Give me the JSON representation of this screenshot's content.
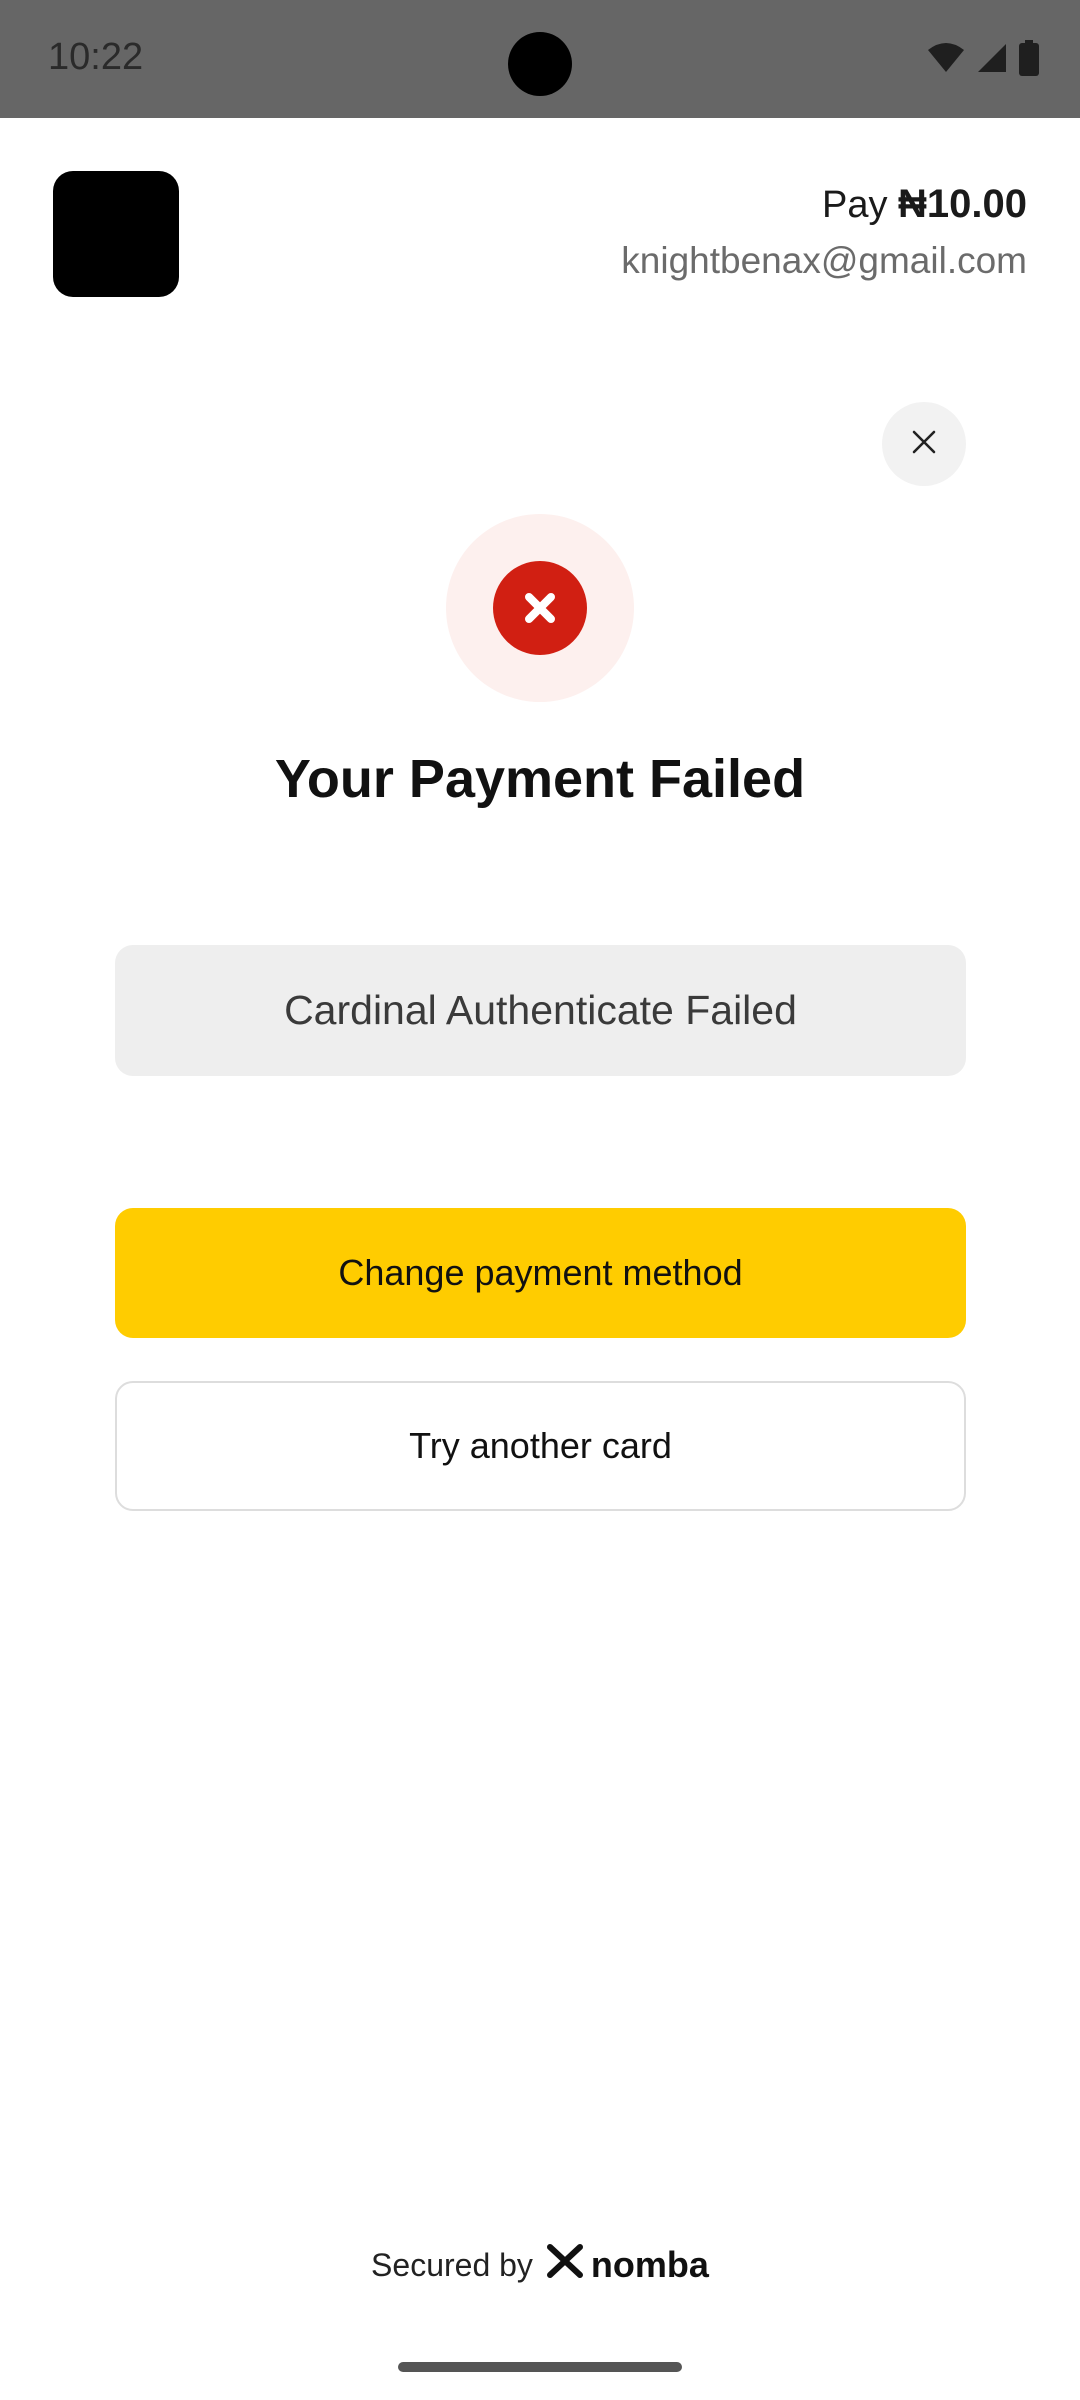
{
  "status_bar": {
    "time": "10:22",
    "icons": [
      "wifi-icon",
      "signal-icon",
      "battery-icon"
    ]
  },
  "header": {
    "pay_prefix": "Pay ",
    "amount": "₦10.00",
    "email": "knightbenax@gmail.com"
  },
  "result": {
    "title": "Your Payment Failed",
    "message": "Cardinal Authenticate Failed",
    "icon": "error-x-icon"
  },
  "actions": {
    "primary_label": "Change payment method",
    "secondary_label": "Try another card",
    "close_icon": "close-icon"
  },
  "footer": {
    "secured_by": "Secured by",
    "brand": "nomba"
  },
  "colors": {
    "accent": "#ffcc00",
    "error": "#d11f12",
    "error_halo": "#fdf0ee",
    "status_bar": "#666666"
  }
}
